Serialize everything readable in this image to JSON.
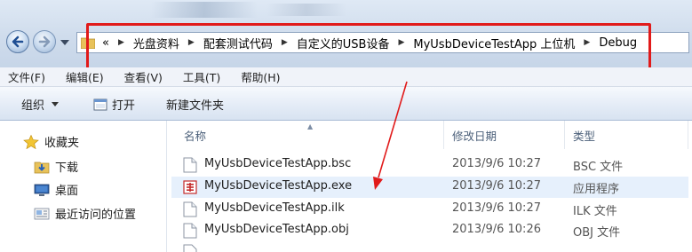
{
  "address": {
    "overflow": "«",
    "crumbs": [
      "光盘资料",
      "配套测试代码",
      "自定义的USB设备",
      "MyUsbDeviceTestApp 上位机",
      "Debug"
    ],
    "separator": "▶"
  },
  "menu": [
    "文件(F)",
    "编辑(E)",
    "查看(V)",
    "工具(T)",
    "帮助(H)"
  ],
  "toolbar": {
    "organize": "组织",
    "open": "打开",
    "new_folder": "新建文件夹"
  },
  "nav": {
    "favorites": "收藏夹",
    "downloads": "下载",
    "desktop": "桌面",
    "recent": "最近访问的位置"
  },
  "columns": {
    "name": "名称",
    "date": "修改日期",
    "type": "类型"
  },
  "files": [
    {
      "name": "MyUsbDeviceTestApp.bsc",
      "date": "2013/9/6 10:27",
      "type": "BSC 文件",
      "icon": "generic-file-icon"
    },
    {
      "name": "MyUsbDeviceTestApp.exe",
      "date": "2013/9/6 10:27",
      "type": "应用程序",
      "icon": "exe-app-icon"
    },
    {
      "name": "MyUsbDeviceTestApp.ilk",
      "date": "2013/9/6 10:27",
      "type": "ILK 文件",
      "icon": "generic-file-icon"
    },
    {
      "name": "MyUsbDeviceTestApp.obj",
      "date": "2013/9/6 10:26",
      "type": "OBJ 文件",
      "icon": "generic-file-icon"
    }
  ],
  "colors": {
    "annotation_red": "#e11a1a",
    "selection": "#e6f0fc"
  }
}
